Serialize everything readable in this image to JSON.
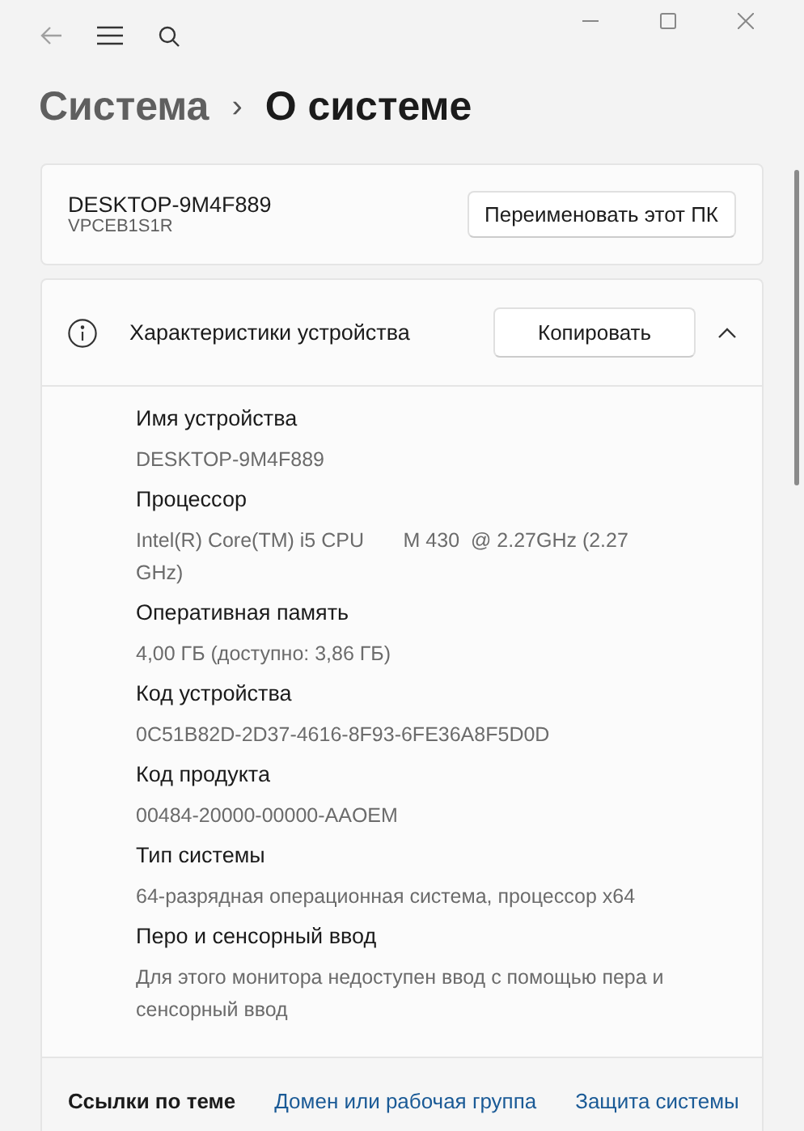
{
  "breadcrumb": {
    "parent": "Система",
    "separator": "›",
    "current": "О системе"
  },
  "device": {
    "name": "DESKTOP-9M4F889",
    "model": "VPCEB1S1R",
    "rename_button": "Переименовать этот ПК"
  },
  "specs": {
    "title": "Характеристики устройства",
    "copy_button": "Копировать",
    "expanded": true,
    "items": [
      {
        "label": "Имя устройства",
        "value": "DESKTOP-9M4F889"
      },
      {
        "label": "Процессор",
        "value": "Intel(R) Core(TM) i5 CPU       M 430  @ 2.27GHz (2.27 GHz)"
      },
      {
        "label": "Оперативная память",
        "value": "4,00 ГБ (доступно: 3,86 ГБ)"
      },
      {
        "label": "Код устройства",
        "value": "0C51B82D-2D37-4616-8F93-6FE36A8F5D0D"
      },
      {
        "label": "Код продукта",
        "value": "00484-20000-00000-AAOEM"
      },
      {
        "label": "Тип системы",
        "value": "64-разрядная операционная система, процессор x64"
      },
      {
        "label": "Перо и сенсорный ввод",
        "value": "Для этого монитора недоступен ввод с помощью пера и сенсорный ввод"
      }
    ]
  },
  "related": {
    "title": "Ссылки по теме",
    "links": [
      "Домен или рабочая группа",
      "Защита системы"
    ]
  }
}
